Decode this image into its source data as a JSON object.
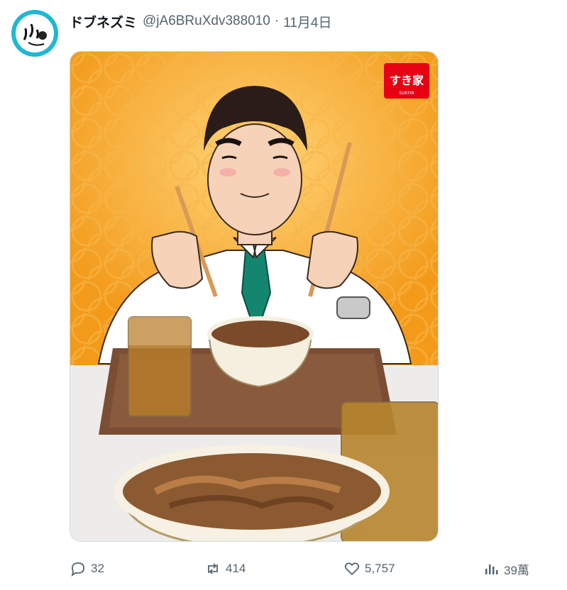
{
  "post": {
    "display_name": "ドブネズミ",
    "handle": "@jA6BRuXdv388010",
    "separator": "·",
    "date": "11月4日"
  },
  "media": {
    "brand_badge_text": "すき家",
    "brand_badge_sub": "SUKIYA"
  },
  "actions": {
    "replies": "32",
    "reposts": "414",
    "likes": "5,757",
    "views": "39萬"
  },
  "colors": {
    "secondary_text": "#536471",
    "avatar_ring": "#1fb7d4",
    "brand_red": "#e60012",
    "background_orange": "#f5a623",
    "tie_green": "#14866f"
  }
}
